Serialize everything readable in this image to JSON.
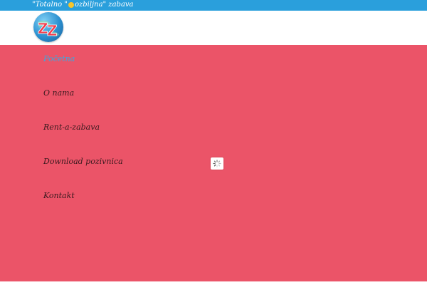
{
  "topbar": {
    "tagline_before": "\"Totalno \"",
    "tagline_sun_icon": "sun-icon",
    "tagline_after": "ozbiljna\" zabava"
  },
  "header": {
    "logo_icon": "zz-globe-logo"
  },
  "nav": {
    "items": [
      {
        "label": "Početna",
        "active": true
      },
      {
        "label": "O nama",
        "active": false
      },
      {
        "label": "Rent-a-zabava",
        "active": false
      },
      {
        "label": "Download pozivnica",
        "active": false
      },
      {
        "label": "Kontakt",
        "active": false
      }
    ]
  },
  "loader": {
    "icon": "spinner-icon"
  },
  "colors": {
    "topbar": "#2a9fdc",
    "main_background": "#eb5468",
    "nav_text": "#3b1a1f",
    "nav_active": "#3aa9e0"
  }
}
